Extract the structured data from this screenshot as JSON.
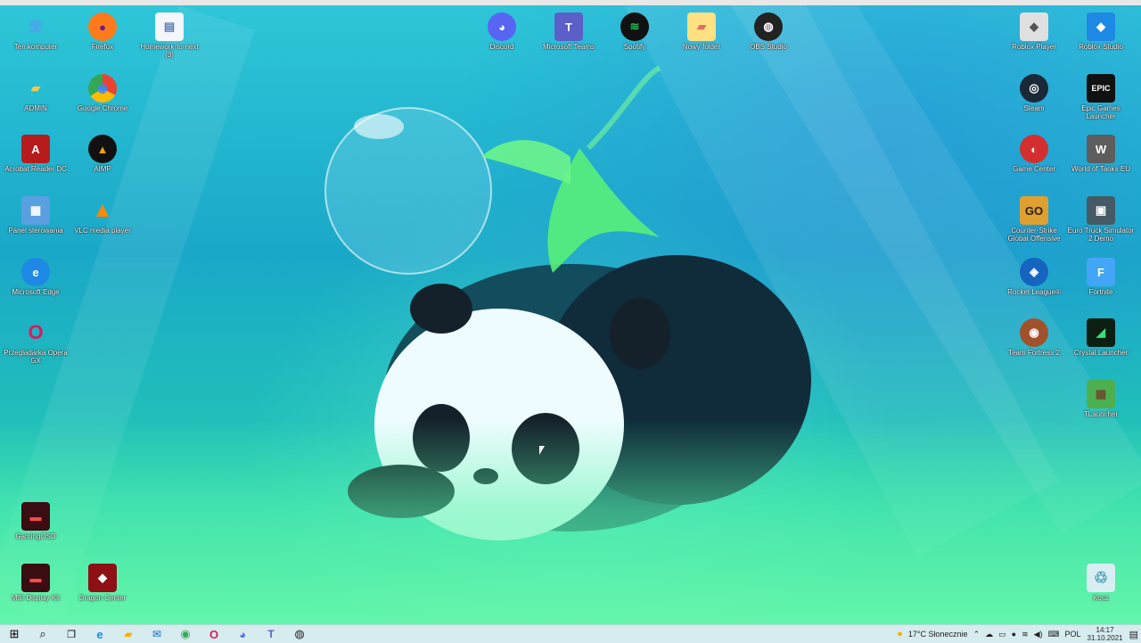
{
  "colors": {
    "taskbar": "#d7ecef",
    "wallpaper_accent": "#1fb7c9"
  },
  "desktop": {
    "icons": [
      {
        "label": "Ten komputer",
        "icon": "computer-icon",
        "color": "#4aa8e8",
        "glyph": "🖥"
      },
      {
        "label": "Firefox",
        "icon": "firefox-icon",
        "color": "#ff7a1a",
        "glyph": "●"
      },
      {
        "label": "Homework-to-next (3)",
        "icon": "document-icon",
        "color": "#e8eef6",
        "glyph": "▤"
      },
      {
        "label": "ADMIN",
        "icon": "user-folder-icon",
        "color": "#f2c94c",
        "glyph": "▰"
      },
      {
        "label": "Google Chrome",
        "icon": "chrome-icon",
        "color": "#34a853",
        "glyph": "◉"
      },
      {
        "label": "Acrobat Reader DC",
        "icon": "acrobat-icon",
        "color": "#b71c1c",
        "glyph": "A"
      },
      {
        "label": "AIMP",
        "icon": "aimp-icon",
        "color": "#f0a500",
        "glyph": "▲"
      },
      {
        "label": "Panel sterowania",
        "icon": "control-panel-icon",
        "color": "#5aa0e0",
        "glyph": "▦"
      },
      {
        "label": "VLC media player",
        "icon": "vlc-icon",
        "color": "#ff8800",
        "glyph": "▲"
      },
      {
        "label": "Microsoft Edge",
        "icon": "edge-icon",
        "color": "#1e88e5",
        "glyph": "e"
      },
      {
        "label": "Przeglądarka Opera GX",
        "icon": "opera-gx-icon",
        "color": "#d81b60",
        "glyph": "O"
      },
      {
        "label": "GamingOSD",
        "icon": "gaming-osd-icon",
        "color": "#c62828",
        "glyph": "▬"
      },
      {
        "label": "MSI Display Kit",
        "icon": "msi-display-kit-icon",
        "color": "#b71c1c",
        "glyph": "▬"
      },
      {
        "label": "Dragon Center",
        "icon": "dragon-center-icon",
        "color": "#c62828",
        "glyph": "◆"
      },
      {
        "label": "Discord",
        "icon": "discord-icon",
        "color": "#5865f2",
        "glyph": "◕"
      },
      {
        "label": "Microsoft Teams",
        "icon": "teams-icon",
        "color": "#5b5fc7",
        "glyph": "T"
      },
      {
        "label": "Spotify",
        "icon": "spotify-icon",
        "color": "#1db954",
        "glyph": "≋"
      },
      {
        "label": "Nowy folder",
        "icon": "folder-icon",
        "color": "#ffe082",
        "glyph": "▰"
      },
      {
        "label": "OBS Studio",
        "icon": "obs-icon",
        "color": "#222222",
        "glyph": "◍"
      },
      {
        "label": "Roblox Player",
        "icon": "roblox-player-icon",
        "color": "#e0e0e0",
        "glyph": "◆"
      },
      {
        "label": "Roblox Studio",
        "icon": "roblox-studio-icon",
        "color": "#1e88e5",
        "glyph": "◆"
      },
      {
        "label": "Steam",
        "icon": "steam-icon",
        "color": "#1b2838",
        "glyph": "◎"
      },
      {
        "label": "Epic Games Launcher",
        "icon": "epic-games-icon",
        "color": "#111111",
        "glyph": "EPIC"
      },
      {
        "label": "Game Center",
        "icon": "game-center-icon",
        "color": "#d32f2f",
        "glyph": "◐"
      },
      {
        "label": "World of Tanks EU",
        "icon": "world-of-tanks-icon",
        "color": "#5d5d5d",
        "glyph": "W"
      },
      {
        "label": "Counter-Strike Global Offensive",
        "icon": "csgo-icon",
        "color": "#e0a030",
        "glyph": "GO"
      },
      {
        "label": "Euro Truck Simulator 2 Demo",
        "icon": "euro-truck-icon",
        "color": "#455a64",
        "glyph": "▣"
      },
      {
        "label": "Rocket League®",
        "icon": "rocket-league-icon",
        "color": "#1565c0",
        "glyph": "◈"
      },
      {
        "label": "Fortnite",
        "icon": "fortnite-icon",
        "color": "#42a5f5",
        "glyph": "F"
      },
      {
        "label": "Team Fortress 2",
        "icon": "tf2-icon",
        "color": "#a0522d",
        "glyph": "◉"
      },
      {
        "label": "Crystal Launcher",
        "icon": "crystal-launcher-icon",
        "color": "#1b5e20",
        "glyph": "◢"
      },
      {
        "label": "TLauncher",
        "icon": "tlauncher-icon",
        "color": "#4caf50",
        "glyph": "▦"
      },
      {
        "label": "Kosz",
        "icon": "recycle-bin-icon",
        "color": "#cfe8ef",
        "glyph": "♲"
      }
    ]
  },
  "taskbar": {
    "items": [
      {
        "name": "start-button",
        "icon": "windows-icon",
        "glyph": "⊞",
        "color": "#000000"
      },
      {
        "name": "search-button",
        "icon": "search-icon",
        "glyph": "⌕",
        "color": "#000000"
      },
      {
        "name": "task-view-button",
        "icon": "task-view-icon",
        "glyph": "❐",
        "color": "#000000"
      },
      {
        "name": "edge-taskbar-button",
        "icon": "edge-icon",
        "glyph": "e",
        "color": "#1e88e5"
      },
      {
        "name": "explorer-taskbar-button",
        "icon": "folder-icon",
        "glyph": "▰",
        "color": "#f2b200"
      },
      {
        "name": "mail-taskbar-button",
        "icon": "mail-icon",
        "glyph": "✉",
        "color": "#1565c0"
      },
      {
        "name": "chrome-taskbar-button",
        "icon": "chrome-icon",
        "glyph": "◉",
        "color": "#34a853"
      },
      {
        "name": "opera-taskbar-button",
        "icon": "opera-icon",
        "glyph": "O",
        "color": "#d81b60"
      },
      {
        "name": "discord-taskbar-button",
        "icon": "discord-icon",
        "glyph": "◕",
        "color": "#5865f2"
      },
      {
        "name": "teams-taskbar-button",
        "icon": "teams-icon",
        "glyph": "T",
        "color": "#5b5fc7"
      },
      {
        "name": "obs-taskbar-button",
        "icon": "obs-icon",
        "glyph": "◍",
        "color": "#222222"
      }
    ],
    "tray": {
      "weather": "17°C  Słonecznie",
      "language": "POL",
      "time": "14:17",
      "date": "31.10.2021"
    }
  }
}
